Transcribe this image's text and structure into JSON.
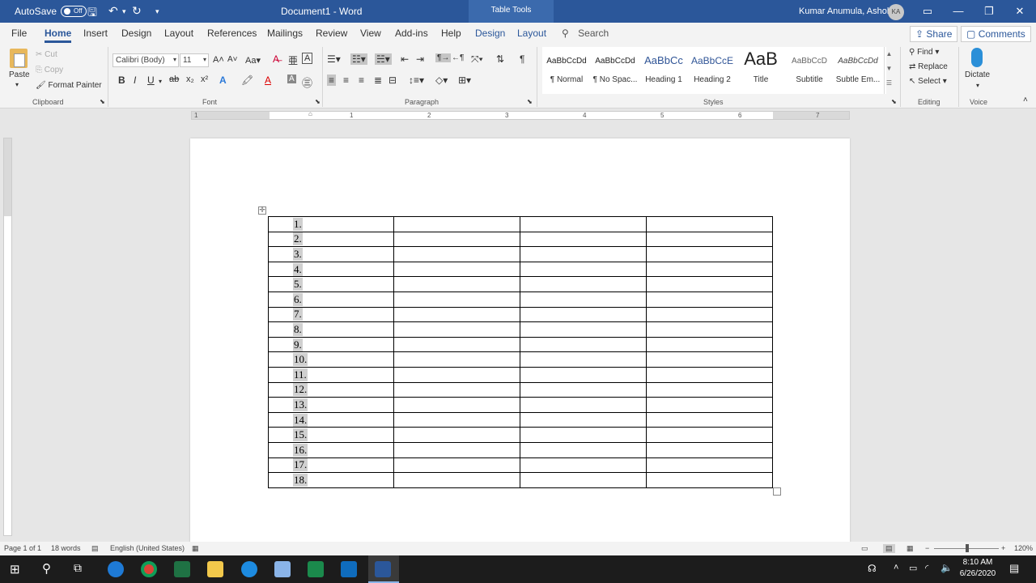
{
  "window": {
    "autosave_label": "AutoSave",
    "autosave_state": "Off",
    "doc_title": "Document1  -  Word",
    "context_tab": "Table Tools",
    "user_name": "Kumar Anumula, Ashok",
    "user_initials": "KA"
  },
  "menu": {
    "tabs": [
      "File",
      "Home",
      "Insert",
      "Design",
      "Layout",
      "References",
      "Mailings",
      "Review",
      "View",
      "Add-ins",
      "Help",
      "Design",
      "Layout"
    ],
    "active_tab": "Home",
    "search_placeholder": "Search",
    "share_label": "Share",
    "comments_label": "Comments"
  },
  "ribbon": {
    "clipboard": {
      "paste": "Paste",
      "cut": "Cut",
      "copy": "Copy",
      "format_painter": "Format Painter",
      "group": "Clipboard"
    },
    "font": {
      "font_name": "Calibri (Body)",
      "font_size": "11",
      "group": "Font"
    },
    "paragraph": {
      "group": "Paragraph"
    },
    "styles": {
      "group": "Styles",
      "items": [
        {
          "sample": "AaBbCcDd",
          "name": "¶ Normal"
        },
        {
          "sample": "AaBbCcDd",
          "name": "¶ No Spac..."
        },
        {
          "sample": "AaBbCc",
          "name": "Heading 1"
        },
        {
          "sample": "AaBbCcE",
          "name": "Heading 2"
        },
        {
          "sample": "AaB",
          "name": "Title"
        },
        {
          "sample": "AaBbCcD",
          "name": "Subtitle"
        },
        {
          "sample": "AaBbCcDd",
          "name": "Subtle Em..."
        }
      ]
    },
    "editing": {
      "find": "Find",
      "replace": "Replace",
      "select": "Select",
      "group": "Editing"
    },
    "voice": {
      "dictate": "Dictate",
      "group": "Voice"
    }
  },
  "ruler": {
    "numbers": [
      "1",
      "1",
      "2",
      "3",
      "4",
      "5",
      "6",
      "7"
    ]
  },
  "table": {
    "columns": 4,
    "rows": [
      "1.",
      "2.",
      "3.",
      "4.",
      "5.",
      "6.",
      "7.",
      "8.",
      "9.",
      "10.",
      "11.",
      "12.",
      "13.",
      "14.",
      "15.",
      "16.",
      "17.",
      "18."
    ]
  },
  "status": {
    "page": "Page 1 of 1",
    "words": "18 words",
    "language": "English (United States)",
    "zoom": "120%"
  },
  "taskbar": {
    "time": "8:10 AM",
    "date": "6/26/2020"
  }
}
